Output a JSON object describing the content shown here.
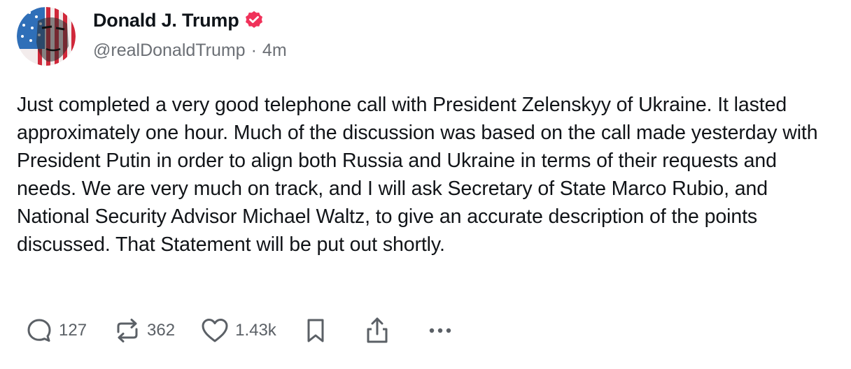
{
  "author": {
    "name": "Donald J. Trump",
    "handle": "@realDonaldTrump",
    "separator": "·",
    "time": "4m"
  },
  "post": {
    "text": "Just completed a very good telephone call with President Zelenskyy of Ukraine. It lasted approximately one hour. Much of the discussion was based on the call made yesterday with President Putin in order to align both Russia and Ukraine in terms of their requests and needs. We are very much on track, and I will ask Secretary of State Marco Rubio, and National Security Advisor Michael Waltz, to give an accurate description of the points discussed. That Statement will be put out shortly."
  },
  "actions": {
    "replies": "127",
    "reposts": "362",
    "likes": "1.43k"
  },
  "icons": {
    "reply": "reply-icon",
    "repost": "repost-icon",
    "like": "heart-icon",
    "bookmark": "bookmark-icon",
    "share": "share-icon",
    "more": "more-icon",
    "verified": "verified-badge-icon"
  },
  "colors": {
    "verified_badge": "#f0325a",
    "secondary_text": "#6b6f75",
    "icon_gray": "#5b6066"
  }
}
